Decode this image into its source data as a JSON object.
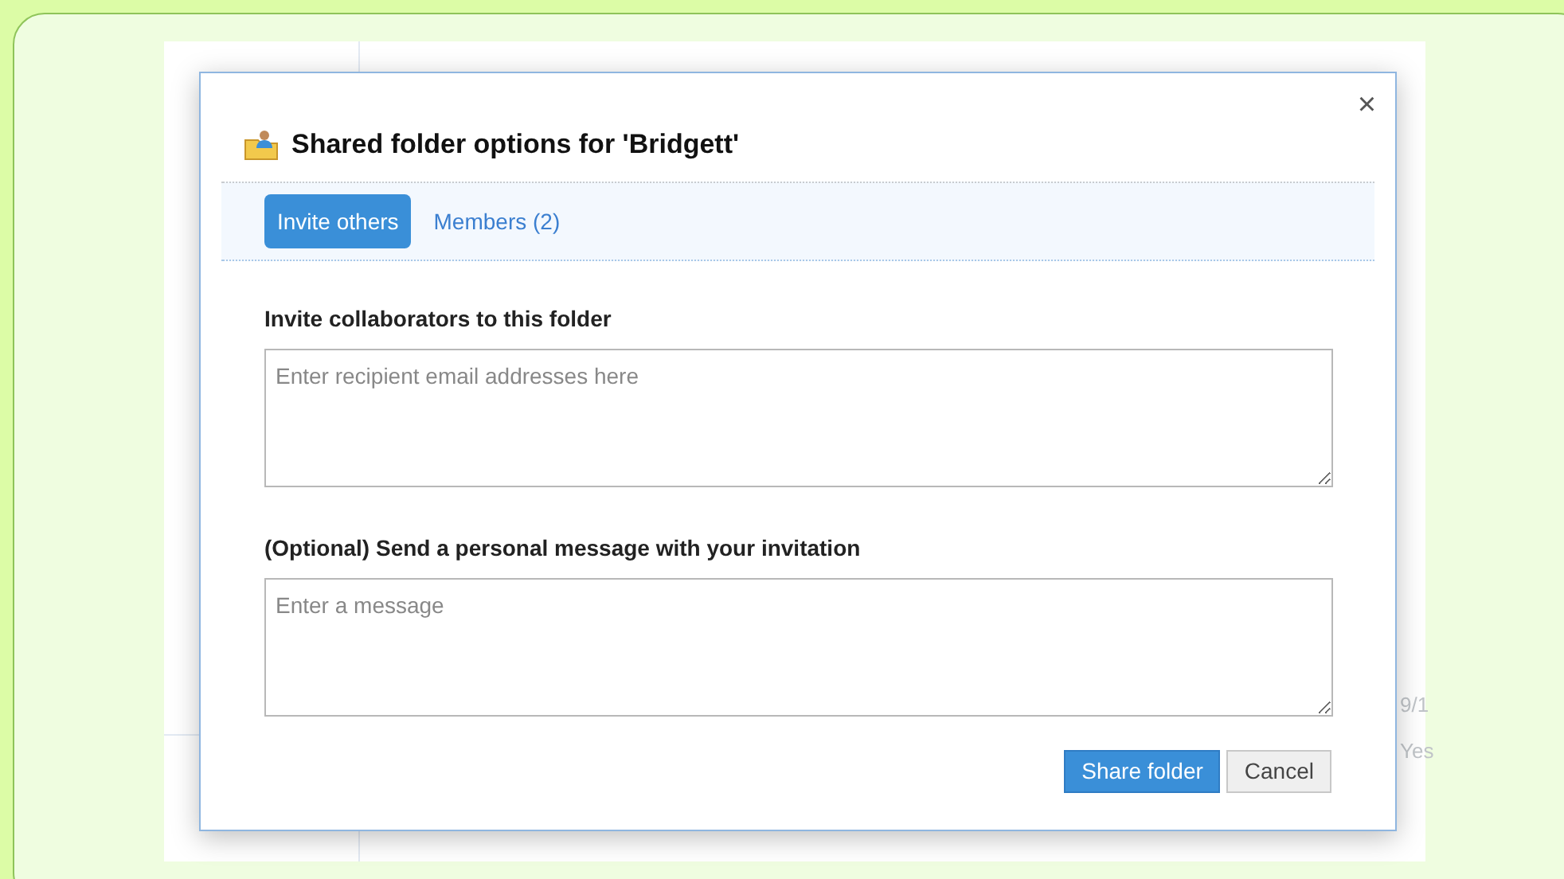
{
  "dialog": {
    "title": "Shared folder options for 'Bridgett'",
    "close": "×",
    "tabs": [
      {
        "label": "Invite others",
        "selected": true
      },
      {
        "label": "Members (2)",
        "selected": false
      }
    ],
    "fields": [
      {
        "label": "Invite collaborators to this folder",
        "placeholder": "Enter recipient email addresses here"
      },
      {
        "label": "(Optional) Send a personal message with your invitation",
        "placeholder": "Enter a message"
      }
    ],
    "buttons": [
      {
        "label": "Share folder",
        "kind": "primary"
      },
      {
        "label": "Cancel",
        "kind": "secondary"
      }
    ]
  },
  "background_texts": [
    "9/1",
    "Yes"
  ]
}
